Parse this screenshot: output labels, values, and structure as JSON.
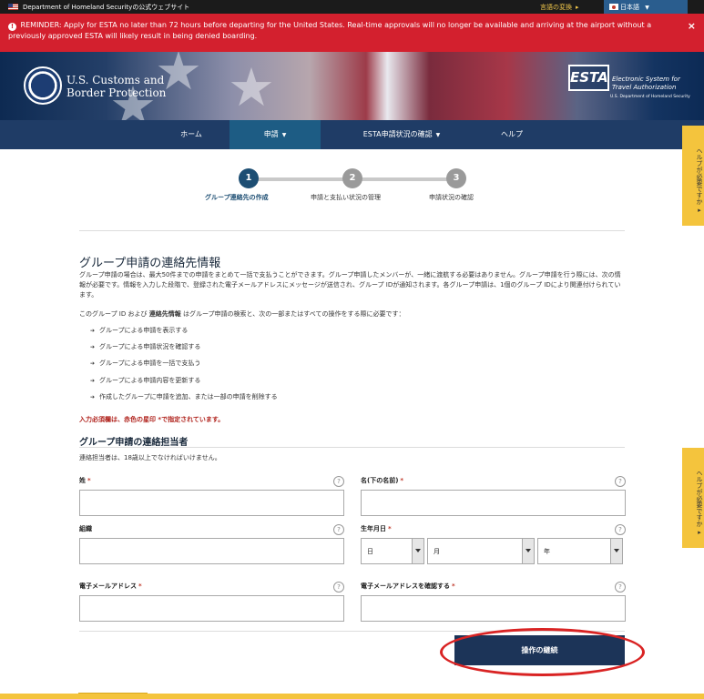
{
  "topbar": {
    "site_label": "Department of Homeland Securityの公式ウェブサイト",
    "language_convert": "言語の変換",
    "language_selected": "日本語"
  },
  "reminder": {
    "text": "REMINDER: Apply for ESTA no later than 72 hours before departing for the United States. Real-time approvals will no longer be available and arriving at the airport without a previously approved ESTA will likely result in being denied boarding.",
    "close": "×"
  },
  "header": {
    "agency_line1": "U.S. Customs and",
    "agency_line2": "Border Protection",
    "esta_logo": "ESTA",
    "esta_line1": "Electronic System for",
    "esta_line2": "Travel Authorization",
    "esta_sub": "U.S. Department of Homeland Security"
  },
  "nav": {
    "home": "ホーム",
    "apply": "申請",
    "status": "ESTA申請状況の確認",
    "help": "ヘルプ"
  },
  "help_tab": "ヘルプが必要ですか",
  "steps": [
    {
      "number": "1",
      "label": "グループ連絡先の作成"
    },
    {
      "number": "2",
      "label": "申請と支払い状況の管理"
    },
    {
      "number": "3",
      "label": "申請状況の確認"
    }
  ],
  "content": {
    "title": "グループ申請の連絡先情報",
    "paragraph1": "グループ申請の場合は、最大50件までの申請をまとめて一括で支払うことができます。グループ申請したメンバーが、一緒に渡航する必要はありません。グループ申請を行う際には、次の情報が必要です。情報を入力した段階で、登録された電子メールアドレスにメッセージが送信され、グループ IDが通知されます。各グループ申請は、1個のグループ IDにより関連付けられています。",
    "paragraph2_a": "このグループ ID および",
    "paragraph2_b": "連絡先情報",
    "paragraph2_c": "はグループ申請の検索と、次の一部またはすべての操作をする際に必要です：",
    "bullets": [
      "グループによる申請を表示する",
      "グループによる申請状況を確認する",
      "グループによる申請を一括で支払う",
      "グループによる申請内容を更新する",
      "作成したグループに申請を追加、または一部の申請を削除する"
    ],
    "required_note": "入力必須欄は、赤色の星印 *で指定されています。",
    "section_title": "グループ申請の連絡担当者",
    "section_note": "連絡担当者は、18歳以上でなければいけません。"
  },
  "form": {
    "last_name": "姓",
    "first_name": "名(下の名前)",
    "organization": "組織",
    "birth_date": "生年月日",
    "day": "日",
    "month": "月",
    "year": "年",
    "email": "電子メールアドレス",
    "email_confirm": "電子メールアドレスを確認する",
    "required_mark": "*",
    "help_mark": "?"
  },
  "continue_button": "操作の継続",
  "colors": {
    "reminder_bg": "#d3202e",
    "nav_bg": "#1f3c66",
    "nav_active": "#1d5c84",
    "step_active": "#1d4e73",
    "help_tab": "#f4c43d",
    "button": "#1c3458",
    "annotation": "#d92323"
  }
}
